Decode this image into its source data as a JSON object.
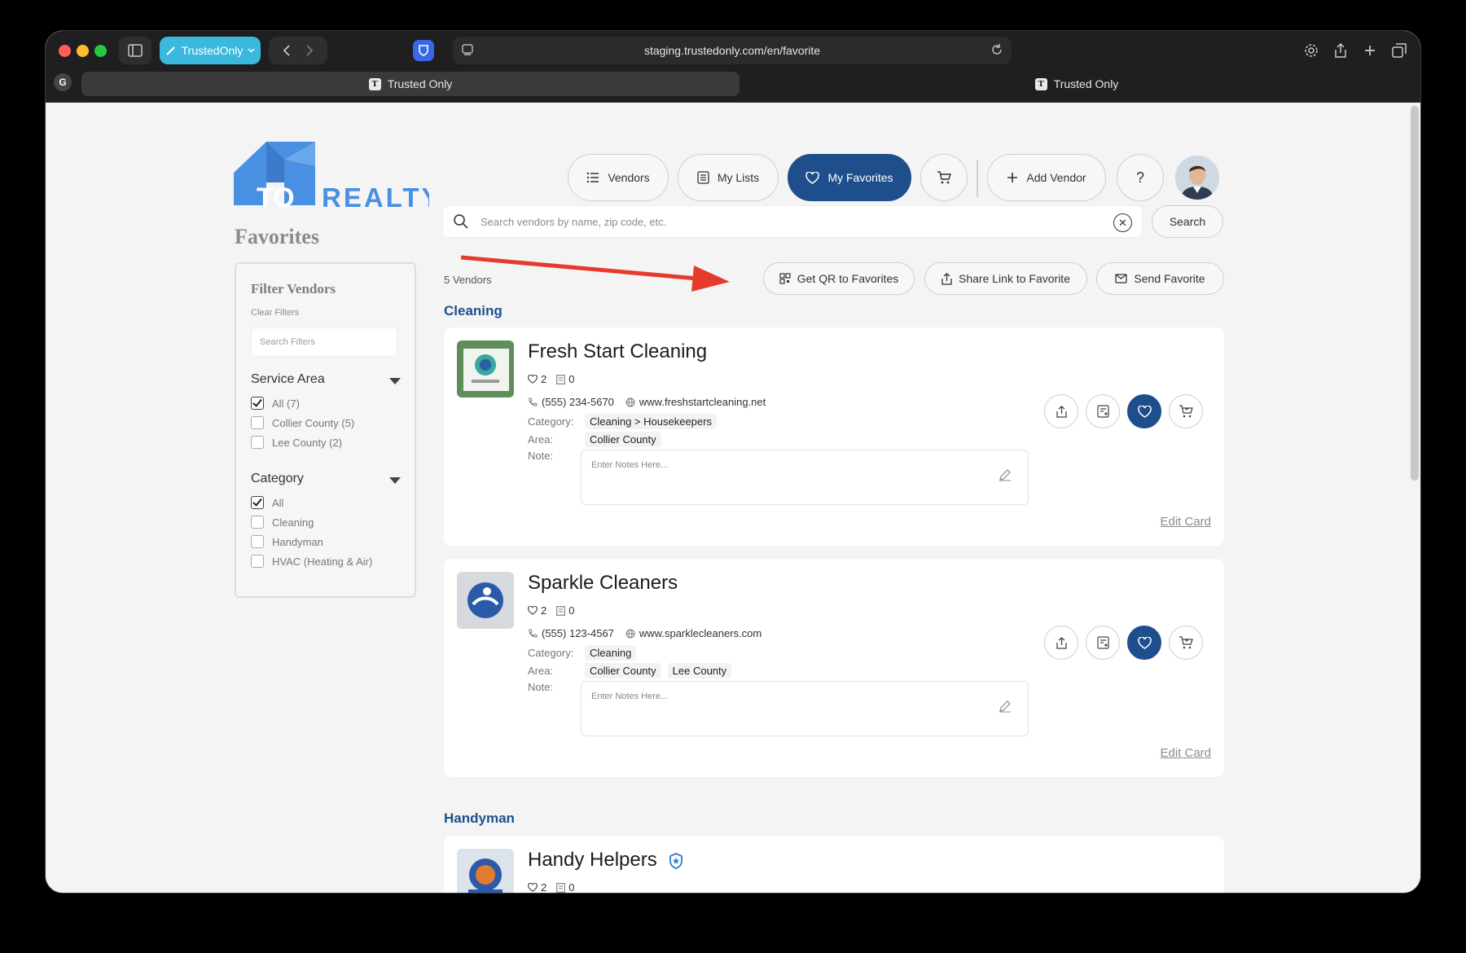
{
  "browser": {
    "profile_label": "TrustedOnly",
    "url": "staging.trustedonly.com/en/favorite",
    "tabs": [
      {
        "label": "Trusted Only",
        "favicon": "T",
        "active": true
      },
      {
        "label": "Trusted Only",
        "favicon": "T",
        "active": false
      }
    ]
  },
  "brand": {
    "logo_text_left": "TO",
    "logo_text_right": "REALTY",
    "color": "#4a90e2"
  },
  "page_title": "Favorites",
  "nav": {
    "vendors": "Vendors",
    "my_lists": "My Lists",
    "my_favorites": "My Favorites",
    "add_vendor": "Add Vendor",
    "help": "?"
  },
  "search": {
    "placeholder": "Search vendors by name, zip code, etc.",
    "button": "Search"
  },
  "sidebar": {
    "title": "Filter Vendors",
    "clear": "Clear Filters",
    "search_placeholder": "Search Filters",
    "service_area": {
      "label": "Service Area",
      "options": [
        {
          "label": "All (7)",
          "checked": true
        },
        {
          "label": "Collier County (5)",
          "checked": false
        },
        {
          "label": "Lee County (2)",
          "checked": false
        }
      ]
    },
    "category": {
      "label": "Category",
      "options": [
        {
          "label": "All",
          "checked": true
        },
        {
          "label": "Cleaning",
          "checked": false
        },
        {
          "label": "Handyman",
          "checked": false
        },
        {
          "label": "HVAC (Heating & Air)",
          "checked": false
        }
      ]
    }
  },
  "results": {
    "count": "5 Vendors",
    "actions": {
      "qr": "Get QR to Favorites",
      "share": "Share Link to Favorite",
      "send": "Send Favorite"
    }
  },
  "groups": [
    {
      "name": "Cleaning",
      "vendors": [
        {
          "name": "Fresh Start Cleaning",
          "favorites": "2",
          "lists": "0",
          "phone": "(555) 234-5670",
          "website": "www.freshstartcleaning.net",
          "category_label": "Category:",
          "category": "Cleaning > Housekeepers",
          "area_label": "Area:",
          "areas": [
            "Collier County"
          ],
          "note_label": "Note:",
          "note_placeholder": "Enter Notes Here...",
          "edit": "Edit Card"
        },
        {
          "name": "Sparkle Cleaners",
          "favorites": "2",
          "lists": "0",
          "phone": "(555) 123-4567",
          "website": "www.sparklecleaners.com",
          "category_label": "Category:",
          "category": "Cleaning",
          "area_label": "Area:",
          "areas": [
            "Collier County",
            "Lee County"
          ],
          "note_label": "Note:",
          "note_placeholder": "Enter Notes Here...",
          "edit": "Edit Card"
        }
      ]
    },
    {
      "name": "Handyman",
      "vendors": [
        {
          "name": "Handy Helpers",
          "favorites": "2",
          "lists": "0"
        }
      ]
    }
  ],
  "colors": {
    "primary": "#1e4f8c",
    "annotation_arrow": "#e53a2c"
  }
}
